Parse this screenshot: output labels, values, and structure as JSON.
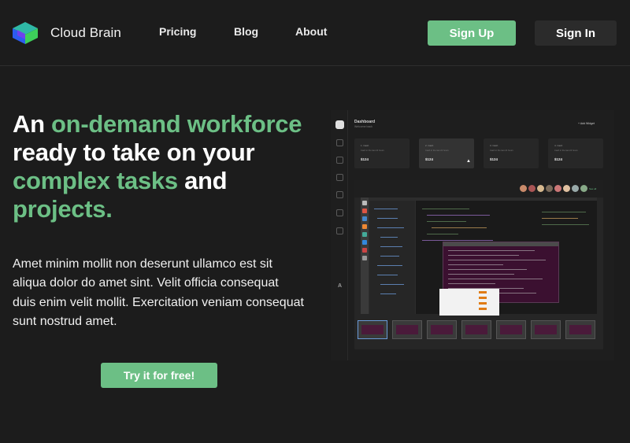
{
  "brand": {
    "name": "Cloud Brain"
  },
  "nav": {
    "links": [
      "Pricing",
      "Blog",
      "About"
    ],
    "signup_label": "Sign Up",
    "signin_label": "Sign In"
  },
  "hero": {
    "headline_1": "An ",
    "headline_2": "on-demand workforce",
    "headline_3": "ready to take on your",
    "headline_4": "complex tasks",
    "headline_5": " and",
    "headline_6": "projects.",
    "description": "Amet minim mollit non deserunt ullamco est sit aliqua dolor do amet sint. Velit officia consequat duis enim velit mollit. Exercitation veniam consequat sunt nostrud amet.",
    "cta_label": "Try it for free!"
  },
  "dashboard_preview": {
    "title": "Dashboard",
    "subtitle": "Welcome back",
    "add_widget": "+ Add Widget",
    "cards": [
      {
        "label": "1. Cash",
        "desc": "Cash in the last 24 hours",
        "value": "$124"
      },
      {
        "label": "2. Cash",
        "desc": "Cash in the last 24 hours",
        "value": "$124"
      },
      {
        "label": "3. Cash",
        "desc": "Cash in the last 24 hours",
        "value": "$124"
      },
      {
        "label": "4. Cash",
        "desc": "Cash in the last 24 hours",
        "value": "$124"
      }
    ],
    "see_all": "See all",
    "sidebar_letter": "A"
  },
  "colors": {
    "accent": "#6cbf85",
    "background": "#1c1c1c",
    "secondary_button": "#2b2b2b"
  }
}
